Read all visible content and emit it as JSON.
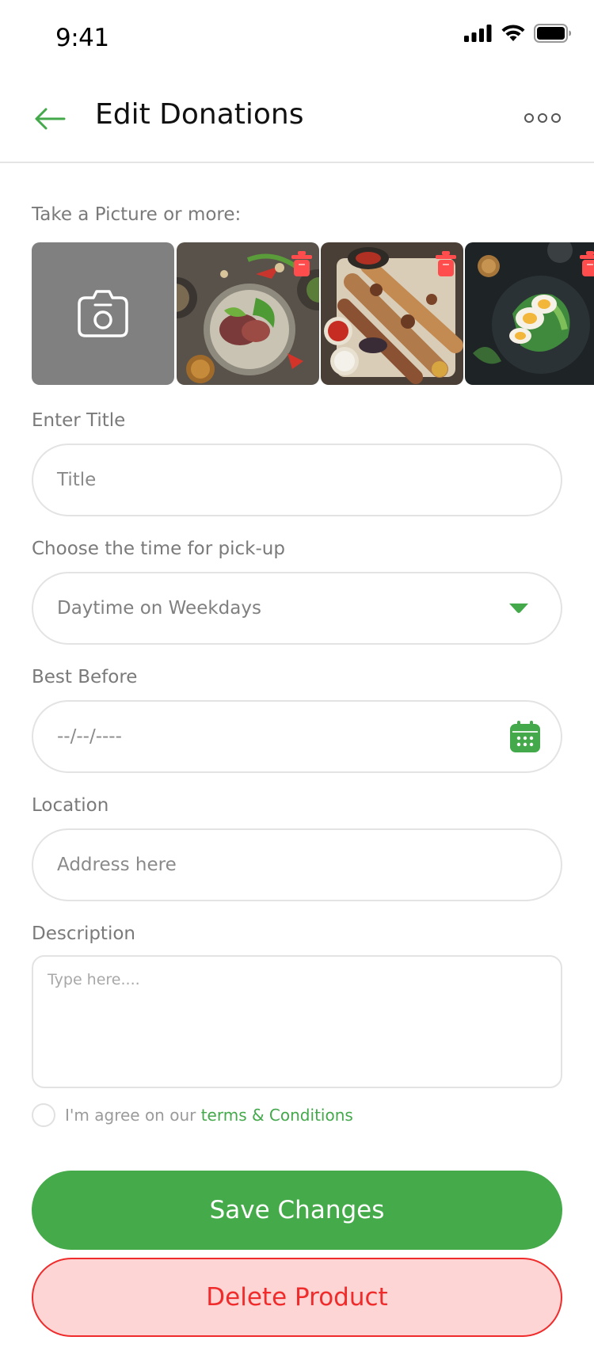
{
  "status_bar": {
    "time": "9:41"
  },
  "header": {
    "title": "Edit Donations"
  },
  "photos": {
    "label": "Take a Picture or more:",
    "items": [
      {
        "name": "steak-salad-photo"
      },
      {
        "name": "grilled-kebab-photo"
      },
      {
        "name": "egg-avocado-photo"
      }
    ]
  },
  "form": {
    "title": {
      "label": "Enter Title",
      "placeholder": "Title"
    },
    "pickup": {
      "label": "Choose the time for pick-up",
      "value": "Daytime on Weekdays"
    },
    "best_before": {
      "label": "Best Before",
      "placeholder": "--/--/----"
    },
    "location": {
      "label": "Location",
      "placeholder": "Address here"
    },
    "description": {
      "label": "Description",
      "placeholder": "Type here...."
    }
  },
  "agreement": {
    "text": "I'm agree on our ",
    "link": "terms & Conditions"
  },
  "buttons": {
    "save": "Save Changes",
    "delete": "Delete Product"
  },
  "colors": {
    "accent": "#45aa4a",
    "danger": "#ef2b2b",
    "danger_bg": "#fdd5d5"
  }
}
